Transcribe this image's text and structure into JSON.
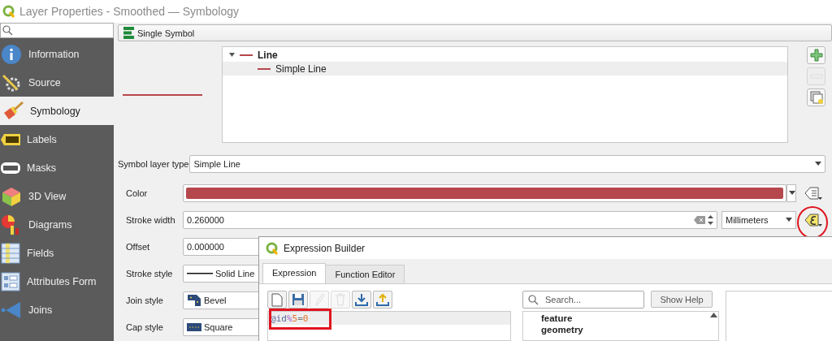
{
  "window": {
    "title": "Layer Properties - Smoothed — Symbology"
  },
  "sidebar": {
    "items": [
      {
        "label": "Information",
        "selected": false
      },
      {
        "label": "Source",
        "selected": false
      },
      {
        "label": "Symbology",
        "selected": true
      },
      {
        "label": "Labels",
        "selected": false
      },
      {
        "label": "Masks",
        "selected": false
      },
      {
        "label": "3D View",
        "selected": false
      },
      {
        "label": "Diagrams",
        "selected": false
      },
      {
        "label": "Fields",
        "selected": false
      },
      {
        "label": "Attributes Form",
        "selected": false
      },
      {
        "label": "Joins",
        "selected": false
      }
    ]
  },
  "renderer": {
    "label": "Single Symbol"
  },
  "symbol_tree": [
    {
      "label": "Line",
      "selected": false,
      "expanded": true,
      "children": [
        {
          "label": "Simple Line",
          "selected": true
        }
      ]
    }
  ],
  "symbol_buttons": [
    {
      "kind": "add",
      "disabled": false
    },
    {
      "kind": "remove",
      "disabled": true
    },
    {
      "kind": "duplicate",
      "disabled": false
    }
  ],
  "symbol_layer_type": {
    "label": "Symbol layer type",
    "value": "Simple Line"
  },
  "properties": [
    {
      "kind": "color",
      "label": "Color",
      "color": "#b5484d",
      "override_highlighted": false
    },
    {
      "kind": "number",
      "label": "Stroke width",
      "value": "0.260000",
      "unit": "Millimeters",
      "override_highlighted": true
    },
    {
      "kind": "number",
      "label": "Offset",
      "value": "0.000000"
    },
    {
      "kind": "line",
      "label": "Stroke style",
      "value": "Solid Line"
    },
    {
      "kind": "join",
      "label": "Join style",
      "value": "Bevel"
    },
    {
      "kind": "cap",
      "label": "Cap style",
      "value": "Square"
    }
  ],
  "expression_builder": {
    "title": "Expression Builder",
    "tabs": [
      {
        "label": "Expression",
        "selected": true
      },
      {
        "label": "Function Editor",
        "selected": false
      }
    ],
    "toolbar": [
      {
        "kind": "new",
        "disabled": false
      },
      {
        "kind": "save",
        "disabled": false
      },
      {
        "kind": "edit",
        "disabled": true
      },
      {
        "kind": "delete",
        "disabled": true
      },
      {
        "kind": "import",
        "disabled": false
      },
      {
        "kind": "export",
        "disabled": false
      }
    ],
    "expression": "@id%5=0",
    "expression_highlighted": true,
    "search": {
      "placeholder": "Search..."
    },
    "show_help": "Show Help",
    "groups": [
      "feature",
      "geometry"
    ]
  }
}
